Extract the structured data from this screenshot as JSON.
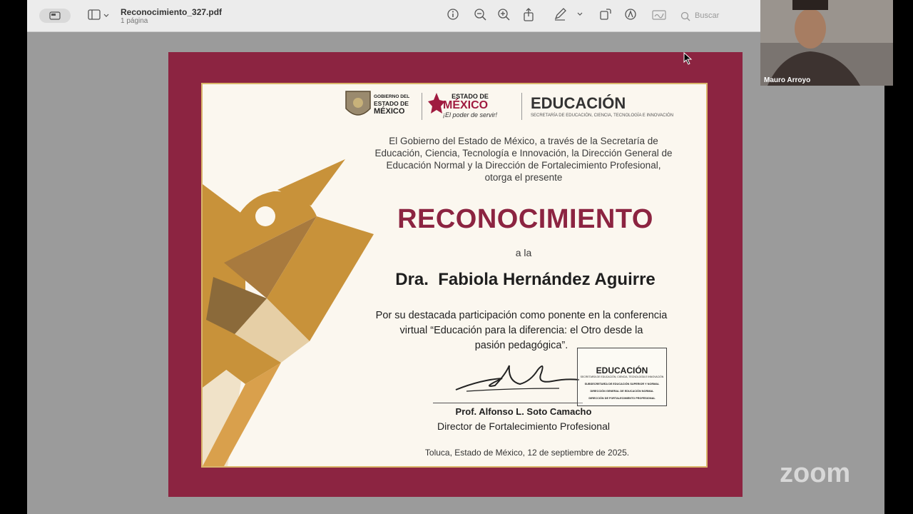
{
  "viewer": {
    "doc_title": "Reconocimiento_327.pdf",
    "doc_pages": "1 página",
    "search_placeholder": "Buscar"
  },
  "certificate": {
    "logos": {
      "gov_line1": "GOBIERNO DEL",
      "gov_line2": "ESTADO DE",
      "gov_line3": "MÉXICO",
      "edomex_line1": "ESTADO DE",
      "edomex_line2": "MÉXICO",
      "edomex_slogan": "¡El poder de servir!",
      "edu_title": "EDUCACIÓN",
      "edu_sub": "SECRETARÍA DE EDUCACIÓN, CIENCIA, TECNOLOGÍA E INNOVACIÓN"
    },
    "intro_1": "El Gobierno del Estado de México, a través de la Secretaría de",
    "intro_2": "Educación, Ciencia, Tecnología e Innovación, la Dirección General de",
    "intro_3": "Educación Normal y la Dirección de Fortalecimiento Profesional,",
    "intro_4": "otorga el presente",
    "heading": "RECONOCIMIENTO",
    "a_la": "a la",
    "recipient": "Dra.  Fabiola Hernández Aguirre",
    "desc_1": "Por su destacada participación como ponente en la conferencia",
    "desc_2": "virtual “Educación para la diferencia: el Otro desde la",
    "desc_3": "pasión pedagógica”.",
    "signer": "Prof. Alfonso L. Soto Camacho",
    "role": "Director de Fortalecimiento Profesional",
    "place_date": "Toluca, Estado de México, 12 de septiembre de 2025.",
    "stamp": {
      "title": "EDUCACIÓN",
      "sub": "SECRETARÍA DE EDUCACIÓN, CIENCIA, TECNOLOGÍA E INNOVACIÓN",
      "line1": "SUBSECRETARÍA DE EDUCACIÓN SUPERIOR Y NORMAL",
      "line2": "DIRECCIÓN GENERAL DE EDUCACIÓN NORMAL",
      "line3": "DIRECCIÓN DE FORTALECIMIENTO PROFESIONAL"
    }
  },
  "zoom": {
    "participant_name": "Mauro Arroyo",
    "logo": "zoom"
  },
  "colors": {
    "maroon": "#8c2441",
    "gold": "#c8923a",
    "paper": "#fbf7ef"
  },
  "icons": [
    "sidebar-toggle-icon",
    "sidebar-icon",
    "chevron-down-icon",
    "info-icon",
    "zoom-out-icon",
    "zoom-in-icon",
    "share-icon",
    "markup-pen-icon",
    "chevron-down-icon",
    "rotate-icon",
    "annotate-icon",
    "sign-icon",
    "search-icon"
  ]
}
